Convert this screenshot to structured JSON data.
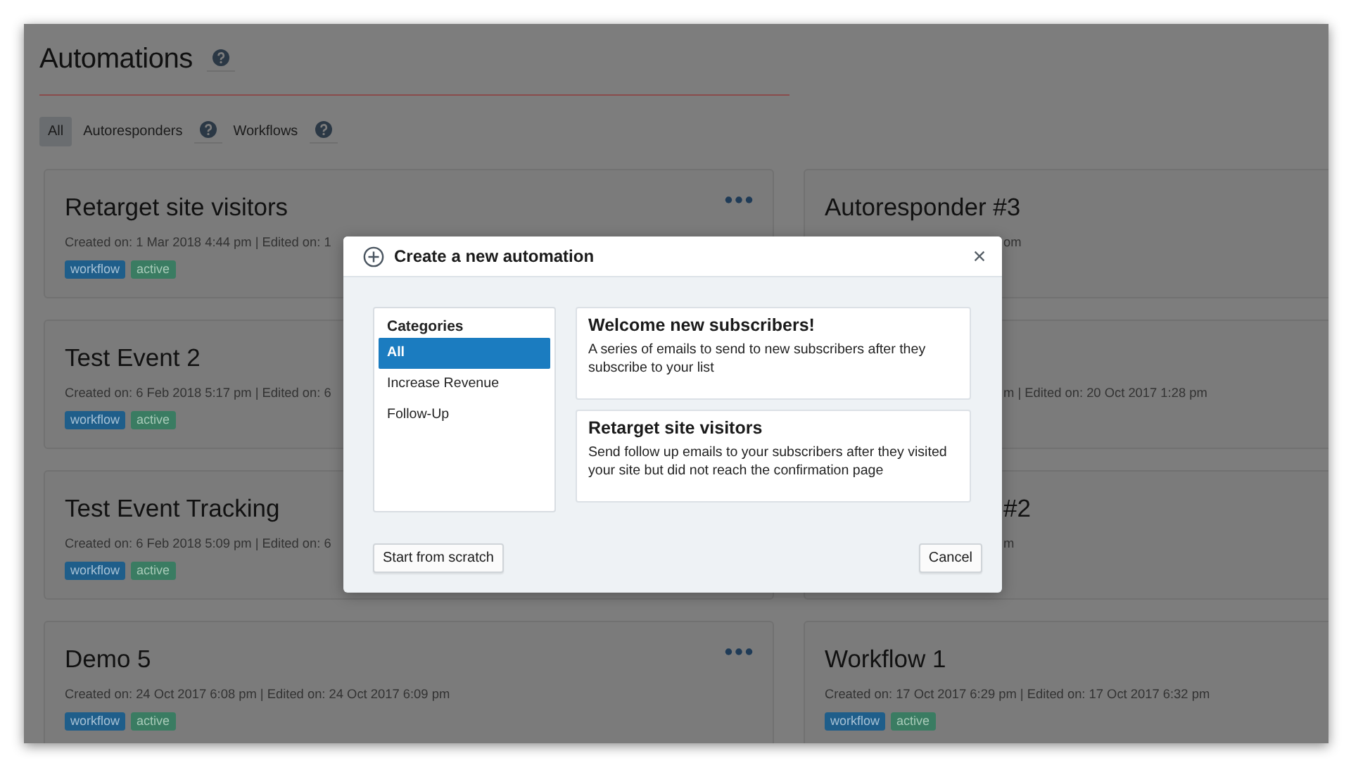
{
  "page": {
    "title": "Automations",
    "help": true
  },
  "filters": [
    {
      "label": "All",
      "selected": true,
      "help": false
    },
    {
      "label": "Autoresponders",
      "selected": false,
      "help": true
    },
    {
      "label": "Workflows",
      "selected": false,
      "help": true
    }
  ],
  "columns": [
    {
      "cards": [
        {
          "title": "Retarget site visitors",
          "meta": "Created on: 1 Mar 2018 4:44 pm | Edited on: 1",
          "menu": true,
          "tags": [
            {
              "label": "workflow",
              "kind": "type"
            },
            {
              "label": "active",
              "kind": "status"
            }
          ]
        },
        {
          "title": "Test Event 2",
          "meta": "Created on: 6 Feb 2018 5:17 pm | Edited on: 6",
          "tags": [
            {
              "label": "workflow",
              "kind": "type"
            },
            {
              "label": "active",
              "kind": "status"
            }
          ]
        },
        {
          "title": "Test Event Tracking",
          "meta": "Created on: 6 Feb 2018 5:09 pm | Edited on: 6",
          "tags": [
            {
              "label": "workflow",
              "kind": "type"
            },
            {
              "label": "active",
              "kind": "status"
            }
          ]
        },
        {
          "title": "Demo 5",
          "meta": "Created on: 24 Oct 2017 6:08 pm | Edited on: 24 Oct 2017 6:09 pm",
          "menu": true,
          "tags": [
            {
              "label": "workflow",
              "kind": "type"
            },
            {
              "label": "active",
              "kind": "status"
            }
          ]
        }
      ]
    },
    {
      "cards": [
        {
          "title": "Autoresponder #3",
          "title_cut": false,
          "meta": "om",
          "meta_cut": true
        },
        {
          "meta": "m | Edited on: 20 Oct 2017 1:28 pm",
          "meta_cut": true
        },
        {
          "title": "#2",
          "title_cut": true,
          "meta": "m",
          "meta_cut": true
        },
        {
          "title": "Workflow 1",
          "title_cut": false,
          "meta": "Created on: 17 Oct 2017 6:29 pm | Edited on: 17 Oct 2017 6:32 pm",
          "meta_cut": false,
          "tags": [
            {
              "label": "workflow",
              "kind": "type"
            },
            {
              "label": "active",
              "kind": "status"
            }
          ]
        }
      ]
    }
  ],
  "modal": {
    "title": "Create a new automation",
    "categories_heading": "Categories",
    "categories": [
      {
        "label": "All",
        "selected": true
      },
      {
        "label": "Increase Revenue",
        "selected": false
      },
      {
        "label": "Follow-Up",
        "selected": false
      }
    ],
    "templates": [
      {
        "title": "Welcome new subscribers!",
        "description": "A series of emails to send to new subscribers after they subscribe to your list"
      },
      {
        "title": "Retarget site visitors",
        "description": "Send follow up emails to your subscribers after they visited your site but did not reach the confirmation page"
      }
    ],
    "buttons": [
      {
        "label": "Start from scratch",
        "kind": "start"
      },
      {
        "label": "Cancel",
        "kind": "cancel"
      }
    ]
  }
}
